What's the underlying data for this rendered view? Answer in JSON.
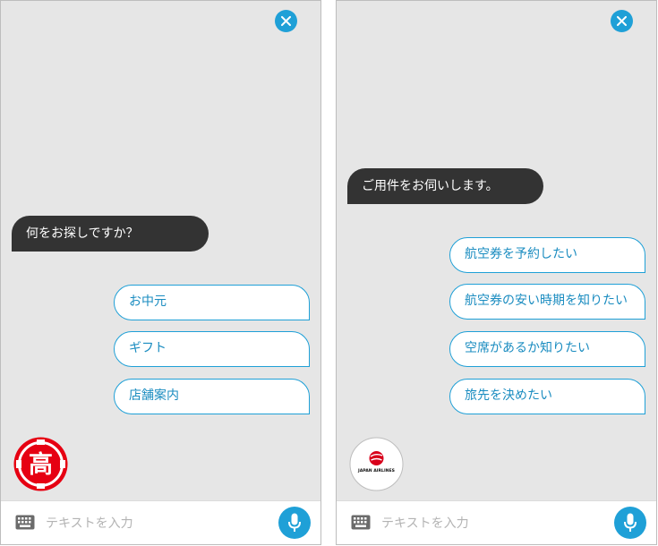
{
  "accent_color": "#1fa0d7",
  "bubble_color": "#333333",
  "left": {
    "bot_message": "何をお探しですか？",
    "options": [
      "お中元",
      "ギフト",
      "店舗案内"
    ],
    "logo_char": "高",
    "input_placeholder": "テキストを入力"
  },
  "right": {
    "bot_message": "ご用件をお伺いします。",
    "options": [
      "航空券を予約したい",
      "航空券の安い時期を知りたい",
      "空席があるか知りたい",
      "旅先を決めたい"
    ],
    "logo_text": "JAPAN AIRLINES",
    "input_placeholder": "テキストを入力"
  },
  "icons": {
    "close": "close-icon",
    "keyboard": "keyboard-icon",
    "mic": "microphone-icon"
  }
}
